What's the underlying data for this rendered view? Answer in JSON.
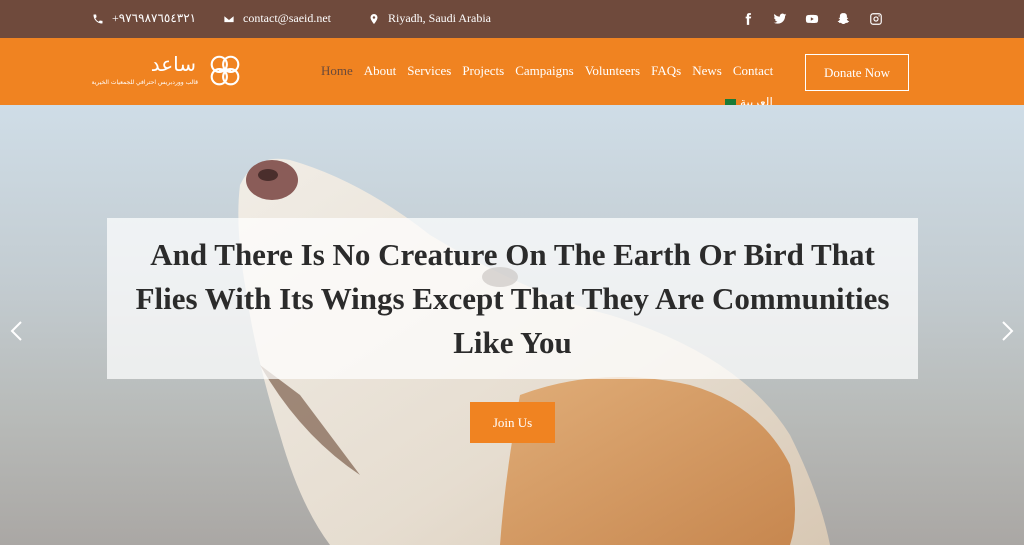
{
  "topbar": {
    "phone": "+٩٧٦٩٨٧٦٥٤٣٢١",
    "email": "contact@saeid.net",
    "location": "Riyadh, Saudi Arabia",
    "socials": [
      "facebook-icon",
      "twitter-icon",
      "youtube-icon",
      "snapchat-icon",
      "instagram-icon"
    ]
  },
  "logo": {
    "name": "ساعد",
    "tagline": "قالب ووردبريس احترافي للجمعيات الخيرية"
  },
  "nav": {
    "items": [
      "Home",
      "About",
      "Services",
      "Projects",
      "Campaigns",
      "Volunteers",
      "FAQs",
      "News",
      "Contact"
    ],
    "active": "Home",
    "language": "العربية",
    "donate_label": "Donate Now"
  },
  "hero": {
    "caption": "And There Is No Creature On The Earth Or Bird That Flies With Its Wings Except That They Are Communities Like You",
    "cta_label": "Join Us"
  },
  "colors": {
    "topbar": "#6f4a3c",
    "accent": "#f08321",
    "active_nav": "#6b4a3a"
  }
}
